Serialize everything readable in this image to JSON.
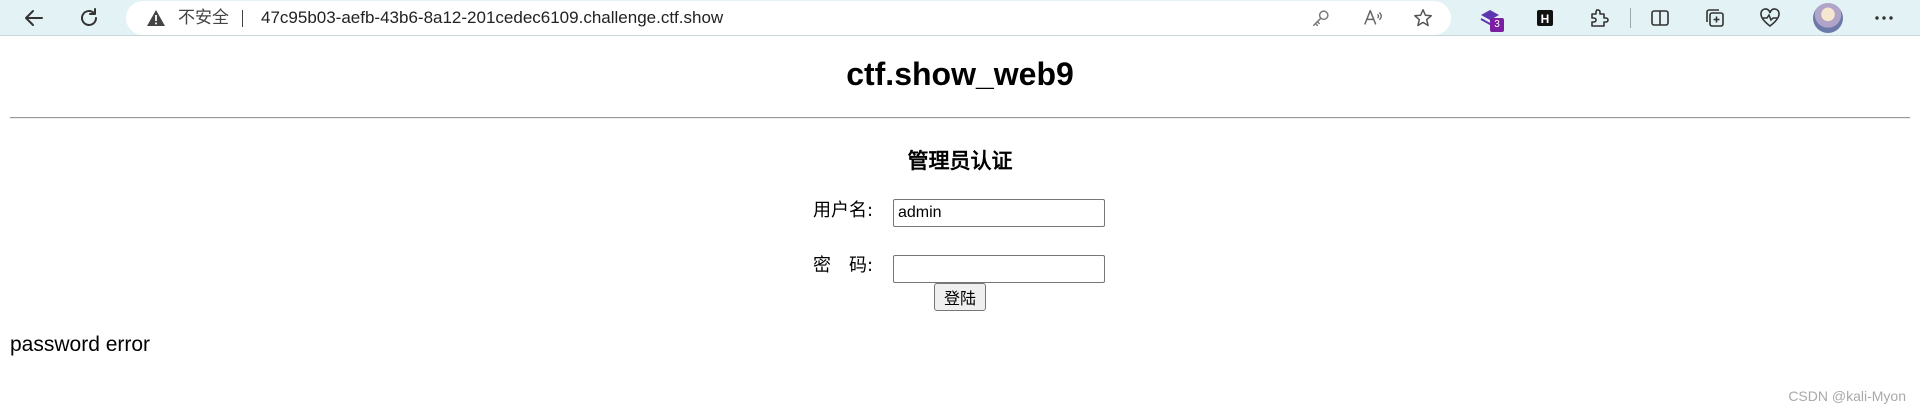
{
  "browser": {
    "security_label": "不安全",
    "url": "47c95b03-aefb-43b6-8a12-201cedec6109.challenge.ctf.show",
    "extension_badge": "3",
    "extension_h_label": "H",
    "icons": [
      "back-icon",
      "refresh-icon",
      "warning-icon",
      "key-icon",
      "read-aloud-icon",
      "favorite-star-icon",
      "extension-icon",
      "h-extension-icon",
      "puzzle-icon",
      "split-screen-icon",
      "collections-icon",
      "health-icon",
      "avatar",
      "more-icon"
    ]
  },
  "page": {
    "title": "ctf.show_web9",
    "form_heading": "管理员认证",
    "username_label": "用户名:",
    "username_value": "admin",
    "password_label": "密　码:",
    "password_value": "",
    "login_button": "登陆",
    "status_message": "password error"
  },
  "watermark": "CSDN @kali-Myon",
  "colors": {
    "chrome_bg": "#e3f2f4",
    "badge": "#7b1fa2",
    "hr": "#999999",
    "watermark": "#a9a9a9"
  }
}
